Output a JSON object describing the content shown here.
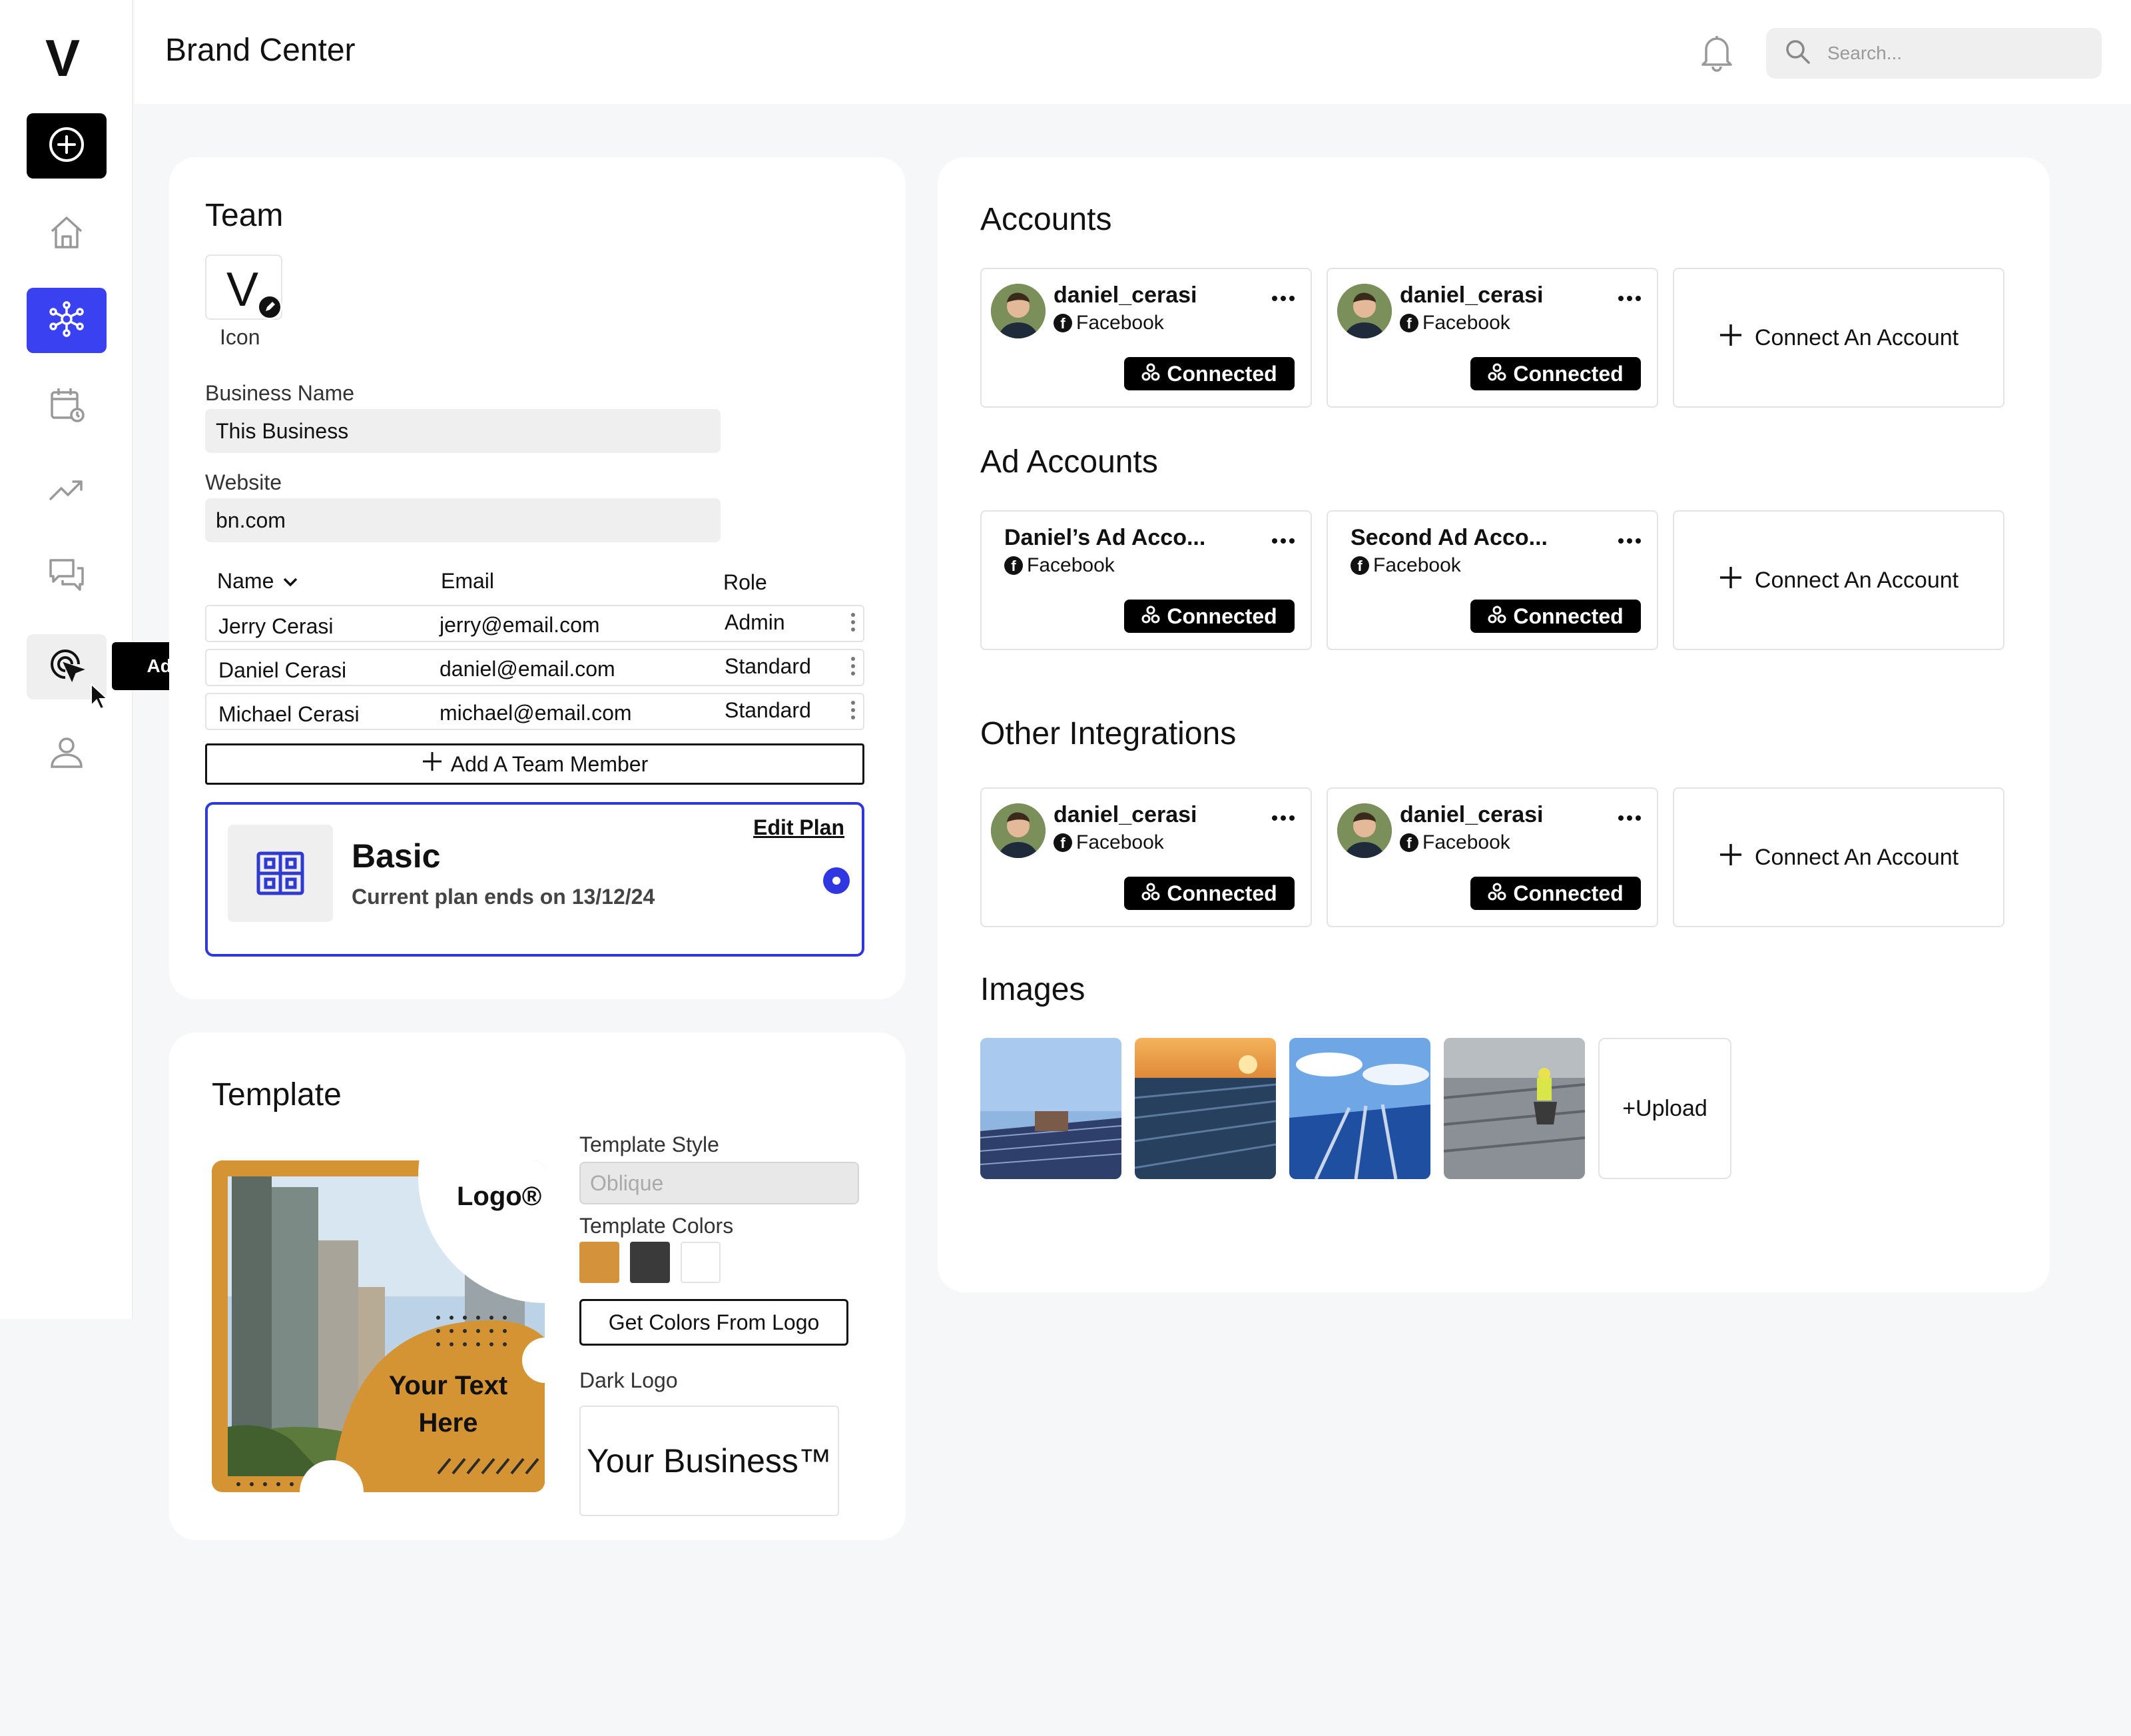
{
  "app": {
    "logo": "V",
    "page_title": "Brand Center"
  },
  "sidebar": {
    "tooltip": "Ads",
    "items": [
      {
        "icon": "plus-circle-icon"
      },
      {
        "icon": "home-icon"
      },
      {
        "icon": "network-icon"
      },
      {
        "icon": "calendar-clock-icon"
      },
      {
        "icon": "trend-icon"
      },
      {
        "icon": "chat-icon"
      },
      {
        "icon": "target-cursor-icon"
      },
      {
        "icon": "user-icon"
      }
    ]
  },
  "search": {
    "placeholder": "Search..."
  },
  "team": {
    "title": "Team",
    "icon_letter": "V",
    "icon_label": "Icon",
    "business_name_label": "Business Name",
    "business_name_value": "This Business",
    "website_label": "Website",
    "website_value": "bn.com",
    "columns": {
      "name": "Name",
      "email": "Email",
      "role": "Role"
    },
    "members": [
      {
        "name": "Jerry Cerasi",
        "email": "jerry@email.com",
        "role": "Admin"
      },
      {
        "name": "Daniel Cerasi",
        "email": "daniel@email.com",
        "role": "Standard"
      },
      {
        "name": "Michael Cerasi",
        "email": "michael@email.com",
        "role": "Standard"
      }
    ],
    "add_member": "Add A Team Member",
    "plan": {
      "name": "Basic",
      "subtitle": "Current plan ends on 13/12/24",
      "edit": "Edit Plan"
    }
  },
  "template": {
    "title": "Template",
    "preview_logo": "Logo®",
    "preview_text": "Your Text Here",
    "style_label": "Template Style",
    "style_value": "Oblique",
    "colors_label": "Template Colors",
    "colors": [
      "#d4933a",
      "#3a3a3a",
      "#ffffff"
    ],
    "get_colors": "Get Colors From Logo",
    "dark_logo_label": "Dark Logo",
    "dark_logo_text": "Your Business™"
  },
  "accounts": {
    "title": "Accounts",
    "items": [
      {
        "name": "daniel_cerasi",
        "platform": "Facebook",
        "status": "Connected"
      },
      {
        "name": "daniel_cerasi",
        "platform": "Facebook",
        "status": "Connected"
      }
    ],
    "connect": "Connect An Account"
  },
  "ad_accounts": {
    "title": "Ad Accounts",
    "items": [
      {
        "name": "Daniel’s Ad Acco...",
        "platform": "Facebook",
        "status": "Connected"
      },
      {
        "name": "Second Ad Acco...",
        "platform": "Facebook",
        "status": "Connected"
      }
    ],
    "connect": "Connect An Account"
  },
  "integrations": {
    "title": "Other Integrations",
    "items": [
      {
        "name": "daniel_cerasi",
        "platform": "Facebook",
        "status": "Connected"
      },
      {
        "name": "daniel_cerasi",
        "platform": "Facebook",
        "status": "Connected"
      }
    ],
    "connect": "Connect An Account"
  },
  "images": {
    "title": "Images",
    "upload": "+Upload"
  }
}
